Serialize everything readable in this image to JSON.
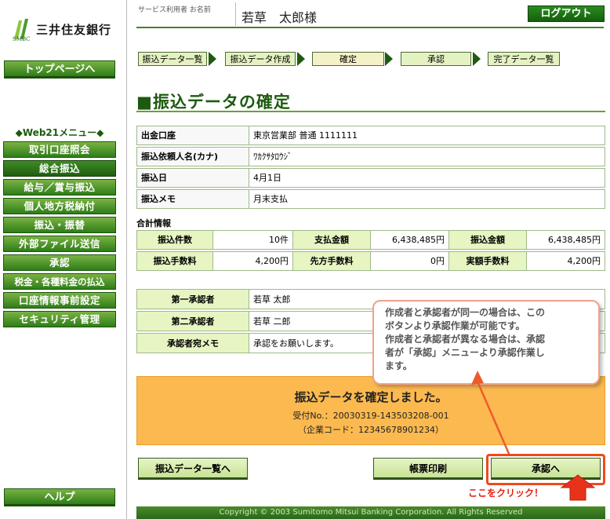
{
  "brand": {
    "name": "三井住友銀行",
    "sub": "SMBC"
  },
  "sidebar": {
    "top_button": "トップページへ",
    "menu_heading": "◆Web21メニュー◆",
    "items": [
      {
        "label": "取引口座照会"
      },
      {
        "label": "総合振込"
      },
      {
        "label": "給与／賞与振込"
      },
      {
        "label": "個人地方税納付"
      },
      {
        "label": "振込・振替"
      },
      {
        "label": "外部ファイル送信"
      },
      {
        "label": "承認"
      },
      {
        "label": "税金・各種料金の払込"
      },
      {
        "label": "口座情報事前設定"
      },
      {
        "label": "セキュリティ管理"
      }
    ],
    "active_item": "総合振込",
    "help_button": "ヘルプ"
  },
  "header": {
    "user_label": "サービス利用者 お名前",
    "user_name": "若草　太郎様",
    "logout": "ログアウト"
  },
  "steps": [
    "振込データ一覧",
    "振込データ作成",
    "確定",
    "承認",
    "完了データ一覧"
  ],
  "current_step": "確定",
  "page_title": "■振込データの確定",
  "transfer": {
    "account_label": "出金口座",
    "account": "東京営業部 普通 1111111",
    "requester_label": "振込依頼人名(カナ)",
    "requester": "ﾜｶｸｻﾀﾛｳｼﾞ",
    "date_label": "振込日",
    "date": "4月1日",
    "memo_label": "振込メモ",
    "memo": "月末支払"
  },
  "summary": {
    "heading": "合計情報",
    "count_label": "振込件数",
    "count": "10件",
    "paid_label": "支払金額",
    "paid": "6,438,485円",
    "amount_label": "振込金額",
    "amount": "6,438,485円",
    "fee_label": "振込手数料",
    "fee": "4,200円",
    "payee_fee_label": "先方手数料",
    "payee_fee": "0円",
    "actual_fee_label": "実額手数料",
    "actual_fee": "4,200円"
  },
  "approval": {
    "first_label": "第一承認者",
    "first": "若草 太郎",
    "second_label": "第二承認者",
    "second": "若草 二郎",
    "memo_label": "承認者宛メモ",
    "memo": "承認をお願いします。"
  },
  "tooltip": {
    "line1": "作成者と承認者が同一の場合は、この",
    "line2": "ボタンより承認作業が可能です。",
    "line3": "作成者と承認者が異なる場合は、承認",
    "line4": "者が「承認」メニューより承認作業し",
    "line5": "ます。"
  },
  "completion": {
    "message": "振込データを確定しました。",
    "receipt": "受付No.：20030319-143503208-001",
    "corp_code": "（企業コード：12345678901234）"
  },
  "buttons": {
    "list": "振込データ一覧へ",
    "print": "帳票印刷",
    "approve": "承認へ",
    "click_here": "ここをクリック！"
  },
  "footer": "Copyright © 2003 Sumitomo Mitsui Banking Corporation. All Rights Reserved",
  "colors": {
    "brand_green": "#2f7d18",
    "panel_orange": "#fbb94f",
    "callout_red": "#ee4a1a"
  }
}
